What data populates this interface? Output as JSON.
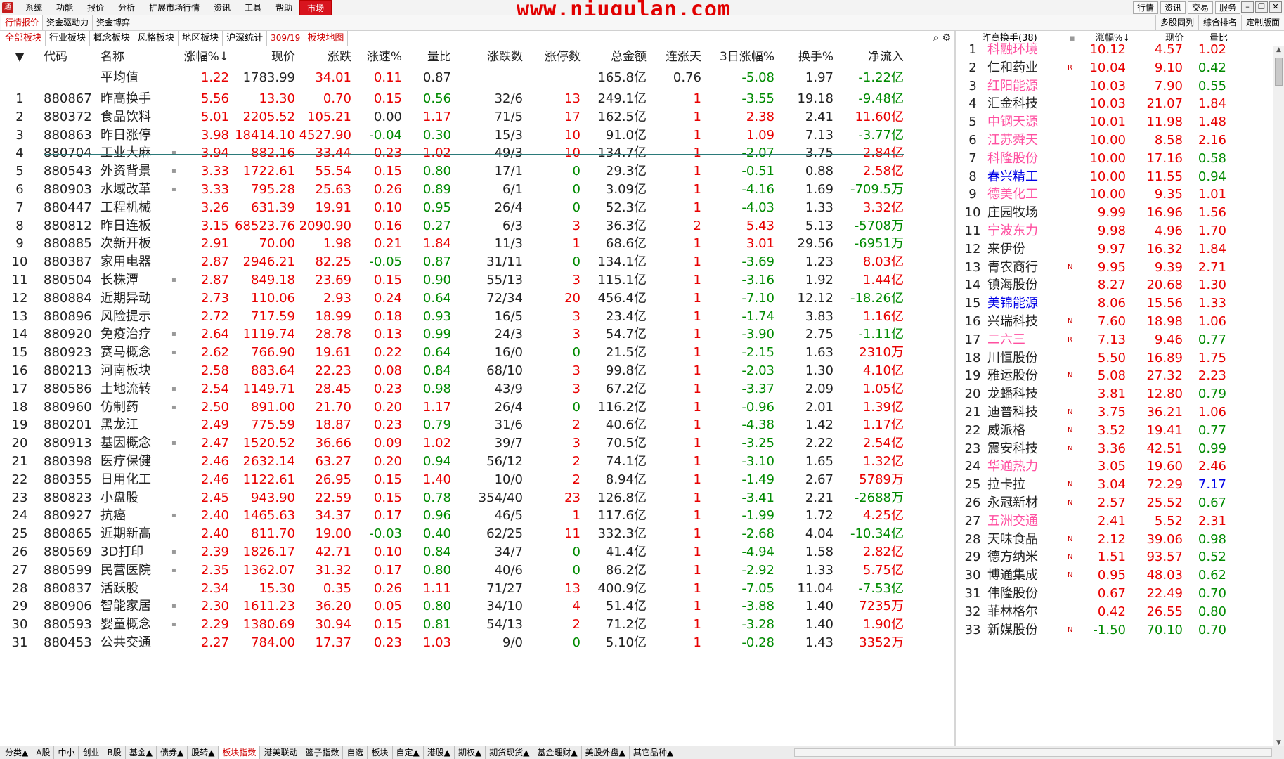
{
  "menubar": {
    "items": [
      "系统",
      "功能",
      "报价",
      "分析",
      "扩展市场行情",
      "资讯",
      "工具",
      "帮助",
      "市场"
    ],
    "watermark": "www.niugulan.com",
    "right_buttons": [
      "行情",
      "资讯",
      "交易",
      "服务"
    ]
  },
  "subbar": {
    "left": [
      "行情报价",
      "资金驱动力",
      "资金博弈"
    ],
    "right": [
      "多股同列",
      "综合排名",
      "定制版面"
    ]
  },
  "catbar": {
    "items": [
      "全部板块",
      "行业板块",
      "概念板块",
      "风格板块",
      "地区板块",
      "沪深统计"
    ],
    "count": "309/19",
    "map": "板块地图"
  },
  "table": {
    "headers": {
      "code": "代码",
      "name": "名称",
      "pct": "涨幅%↓",
      "price": "现价",
      "chg": "涨跌",
      "speed": "涨速%",
      "vr": "量比",
      "ud": "涨跌数",
      "lim": "涨停数",
      "amt": "总金额",
      "days": "连涨天",
      "d3": "3日涨幅%",
      "turn": "换手%",
      "net": "净流入"
    },
    "avg": {
      "name": "平均值",
      "pct": "1.22",
      "price": "1783.99",
      "chg": "34.01",
      "speed": "0.11",
      "vr": "0.87",
      "amt": "165.8亿",
      "days": "0.76",
      "d3": "-5.08",
      "turn": "1.97",
      "net": "-1.22亿"
    },
    "rows": [
      {
        "idx": "1",
        "code": "880867",
        "name": "昨高换手",
        "dot": false,
        "pct": "5.56",
        "price": "13.30",
        "chg": "0.70",
        "speed": "0.15",
        "vr": "0.56",
        "ud": "32/6",
        "lim": "13",
        "amt": "249.1亿",
        "days": "1",
        "d3": "-3.55",
        "turn": "19.18",
        "net": "-9.48亿"
      },
      {
        "idx": "2",
        "code": "880372",
        "name": "食品饮料",
        "dot": false,
        "pct": "5.01",
        "price": "2205.52",
        "chg": "105.21",
        "speed": "0.00",
        "vr": "1.17",
        "ud": "71/5",
        "lim": "17",
        "amt": "162.5亿",
        "days": "1",
        "d3": "2.38",
        "turn": "2.41",
        "net": "11.60亿"
      },
      {
        "idx": "3",
        "code": "880863",
        "name": "昨日涨停",
        "dot": false,
        "pct": "3.98",
        "price": "18414.10",
        "chg": "4527.90",
        "speed": "-0.04",
        "vr": "0.30",
        "ud": "15/3",
        "lim": "10",
        "amt": "91.0亿",
        "days": "1",
        "d3": "1.09",
        "turn": "7.13",
        "net": "-3.77亿"
      },
      {
        "idx": "4",
        "code": "880704",
        "name": "工业大麻",
        "dot": true,
        "pct": "3.94",
        "price": "882.16",
        "chg": "33.44",
        "speed": "0.23",
        "vr": "1.02",
        "ud": "49/3",
        "lim": "10",
        "amt": "134.7亿",
        "days": "1",
        "d3": "-2.07",
        "turn": "3.75",
        "net": "2.84亿"
      },
      {
        "idx": "5",
        "code": "880543",
        "name": "外资背景",
        "dot": true,
        "pct": "3.33",
        "price": "1722.61",
        "chg": "55.54",
        "speed": "0.15",
        "vr": "0.80",
        "ud": "17/1",
        "lim": "0",
        "amt": "29.3亿",
        "days": "1",
        "d3": "-0.51",
        "turn": "0.88",
        "net": "2.58亿"
      },
      {
        "idx": "6",
        "code": "880903",
        "name": "水域改革",
        "dot": true,
        "pct": "3.33",
        "price": "795.28",
        "chg": "25.63",
        "speed": "0.26",
        "vr": "0.89",
        "ud": "6/1",
        "lim": "0",
        "amt": "3.09亿",
        "days": "1",
        "d3": "-4.16",
        "turn": "1.69",
        "net": "-709.5万"
      },
      {
        "idx": "7",
        "code": "880447",
        "name": "工程机械",
        "dot": false,
        "pct": "3.26",
        "price": "631.39",
        "chg": "19.91",
        "speed": "0.10",
        "vr": "0.95",
        "ud": "26/4",
        "lim": "0",
        "amt": "52.3亿",
        "days": "1",
        "d3": "-4.03",
        "turn": "1.33",
        "net": "3.32亿"
      },
      {
        "idx": "8",
        "code": "880812",
        "name": "昨日连板",
        "dot": false,
        "pct": "3.15",
        "price": "68523.76",
        "chg": "2090.90",
        "speed": "0.16",
        "vr": "0.27",
        "ud": "6/3",
        "lim": "3",
        "amt": "36.3亿",
        "days": "2",
        "d3": "5.43",
        "turn": "5.13",
        "net": "-5708万"
      },
      {
        "idx": "9",
        "code": "880885",
        "name": "次新开板",
        "dot": false,
        "pct": "2.91",
        "price": "70.00",
        "chg": "1.98",
        "speed": "0.21",
        "vr": "1.84",
        "ud": "11/3",
        "lim": "1",
        "amt": "68.6亿",
        "days": "1",
        "d3": "3.01",
        "turn": "29.56",
        "net": "-6951万"
      },
      {
        "idx": "10",
        "code": "880387",
        "name": "家用电器",
        "dot": false,
        "pct": "2.87",
        "price": "2946.21",
        "chg": "82.25",
        "speed": "-0.05",
        "vr": "0.87",
        "ud": "31/11",
        "lim": "0",
        "amt": "134.1亿",
        "days": "1",
        "d3": "-3.69",
        "turn": "1.23",
        "net": "8.03亿"
      },
      {
        "idx": "11",
        "code": "880504",
        "name": "长株潭",
        "dot": true,
        "pct": "2.87",
        "price": "849.18",
        "chg": "23.69",
        "speed": "0.15",
        "vr": "0.90",
        "ud": "55/13",
        "lim": "3",
        "amt": "115.1亿",
        "days": "1",
        "d3": "-3.16",
        "turn": "1.92",
        "net": "1.44亿"
      },
      {
        "idx": "12",
        "code": "880884",
        "name": "近期异动",
        "dot": false,
        "pct": "2.73",
        "price": "110.06",
        "chg": "2.93",
        "speed": "0.24",
        "vr": "0.64",
        "ud": "72/34",
        "lim": "20",
        "amt": "456.4亿",
        "days": "1",
        "d3": "-7.10",
        "turn": "12.12",
        "net": "-18.26亿"
      },
      {
        "idx": "13",
        "code": "880896",
        "name": "风险提示",
        "dot": false,
        "pct": "2.72",
        "price": "717.59",
        "chg": "18.99",
        "speed": "0.18",
        "vr": "0.93",
        "ud": "16/5",
        "lim": "3",
        "amt": "23.4亿",
        "days": "1",
        "d3": "-1.74",
        "turn": "3.83",
        "net": "1.16亿"
      },
      {
        "idx": "14",
        "code": "880920",
        "name": "免疫治疗",
        "dot": true,
        "pct": "2.64",
        "price": "1119.74",
        "chg": "28.78",
        "speed": "0.13",
        "vr": "0.99",
        "ud": "24/3",
        "lim": "3",
        "amt": "54.7亿",
        "days": "1",
        "d3": "-3.90",
        "turn": "2.75",
        "net": "-1.11亿"
      },
      {
        "idx": "15",
        "code": "880923",
        "name": "赛马概念",
        "dot": true,
        "pct": "2.62",
        "price": "766.90",
        "chg": "19.61",
        "speed": "0.22",
        "vr": "0.64",
        "ud": "16/0",
        "lim": "0",
        "amt": "21.5亿",
        "days": "1",
        "d3": "-2.15",
        "turn": "1.63",
        "net": "2310万"
      },
      {
        "idx": "16",
        "code": "880213",
        "name": "河南板块",
        "dot": false,
        "pct": "2.58",
        "price": "883.64",
        "chg": "22.23",
        "speed": "0.08",
        "vr": "0.84",
        "ud": "68/10",
        "lim": "3",
        "amt": "99.8亿",
        "days": "1",
        "d3": "-2.03",
        "turn": "1.30",
        "net": "4.10亿"
      },
      {
        "idx": "17",
        "code": "880586",
        "name": "土地流转",
        "dot": true,
        "pct": "2.54",
        "price": "1149.71",
        "chg": "28.45",
        "speed": "0.23",
        "vr": "0.98",
        "ud": "43/9",
        "lim": "3",
        "amt": "67.2亿",
        "days": "1",
        "d3": "-3.37",
        "turn": "2.09",
        "net": "1.05亿"
      },
      {
        "idx": "18",
        "code": "880960",
        "name": "仿制药",
        "dot": true,
        "pct": "2.50",
        "price": "891.00",
        "chg": "21.70",
        "speed": "0.20",
        "vr": "1.17",
        "ud": "26/4",
        "lim": "0",
        "amt": "116.2亿",
        "days": "1",
        "d3": "-0.96",
        "turn": "2.01",
        "net": "1.39亿"
      },
      {
        "idx": "19",
        "code": "880201",
        "name": "黑龙江",
        "dot": false,
        "pct": "2.49",
        "price": "775.59",
        "chg": "18.87",
        "speed": "0.23",
        "vr": "0.79",
        "ud": "31/6",
        "lim": "2",
        "amt": "40.6亿",
        "days": "1",
        "d3": "-4.38",
        "turn": "1.42",
        "net": "1.17亿"
      },
      {
        "idx": "20",
        "code": "880913",
        "name": "基因概念",
        "dot": true,
        "pct": "2.47",
        "price": "1520.52",
        "chg": "36.66",
        "speed": "0.09",
        "vr": "1.02",
        "ud": "39/7",
        "lim": "3",
        "amt": "70.5亿",
        "days": "1",
        "d3": "-3.25",
        "turn": "2.22",
        "net": "2.54亿"
      },
      {
        "idx": "21",
        "code": "880398",
        "name": "医疗保健",
        "dot": false,
        "pct": "2.46",
        "price": "2632.14",
        "chg": "63.27",
        "speed": "0.20",
        "vr": "0.94",
        "ud": "56/12",
        "lim": "2",
        "amt": "74.1亿",
        "days": "1",
        "d3": "-3.10",
        "turn": "1.65",
        "net": "1.32亿"
      },
      {
        "idx": "22",
        "code": "880355",
        "name": "日用化工",
        "dot": false,
        "pct": "2.46",
        "price": "1122.61",
        "chg": "26.95",
        "speed": "0.15",
        "vr": "1.40",
        "ud": "10/0",
        "lim": "2",
        "amt": "8.94亿",
        "days": "1",
        "d3": "-1.49",
        "turn": "2.67",
        "net": "5789万"
      },
      {
        "idx": "23",
        "code": "880823",
        "name": "小盘股",
        "dot": false,
        "pct": "2.45",
        "price": "943.90",
        "chg": "22.59",
        "speed": "0.15",
        "vr": "0.78",
        "ud": "354/40",
        "lim": "23",
        "amt": "126.8亿",
        "days": "1",
        "d3": "-3.41",
        "turn": "2.21",
        "net": "-2688万"
      },
      {
        "idx": "24",
        "code": "880927",
        "name": "抗癌",
        "dot": true,
        "pct": "2.40",
        "price": "1465.63",
        "chg": "34.37",
        "speed": "0.17",
        "vr": "0.96",
        "ud": "46/5",
        "lim": "1",
        "amt": "117.6亿",
        "days": "1",
        "d3": "-1.99",
        "turn": "1.72",
        "net": "4.25亿"
      },
      {
        "idx": "25",
        "code": "880865",
        "name": "近期新高",
        "dot": false,
        "pct": "2.40",
        "price": "811.70",
        "chg": "19.00",
        "speed": "-0.03",
        "vr": "0.40",
        "ud": "62/25",
        "lim": "11",
        "amt": "332.3亿",
        "days": "1",
        "d3": "-2.68",
        "turn": "4.04",
        "net": "-10.34亿"
      },
      {
        "idx": "26",
        "code": "880569",
        "name": "3D打印",
        "dot": true,
        "pct": "2.39",
        "price": "1826.17",
        "chg": "42.71",
        "speed": "0.10",
        "vr": "0.84",
        "ud": "34/7",
        "lim": "0",
        "amt": "41.4亿",
        "days": "1",
        "d3": "-4.94",
        "turn": "1.58",
        "net": "2.82亿"
      },
      {
        "idx": "27",
        "code": "880599",
        "name": "民营医院",
        "dot": true,
        "pct": "2.35",
        "price": "1362.07",
        "chg": "31.32",
        "speed": "0.17",
        "vr": "0.80",
        "ud": "40/6",
        "lim": "0",
        "amt": "86.2亿",
        "days": "1",
        "d3": "-2.92",
        "turn": "1.33",
        "net": "5.75亿"
      },
      {
        "idx": "28",
        "code": "880837",
        "name": "活跃股",
        "dot": false,
        "pct": "2.34",
        "price": "15.30",
        "chg": "0.35",
        "speed": "0.26",
        "vr": "1.11",
        "ud": "71/27",
        "lim": "13",
        "amt": "400.9亿",
        "days": "1",
        "d3": "-7.05",
        "turn": "11.04",
        "net": "-7.53亿"
      },
      {
        "idx": "29",
        "code": "880906",
        "name": "智能家居",
        "dot": true,
        "pct": "2.30",
        "price": "1611.23",
        "chg": "36.20",
        "speed": "0.05",
        "vr": "0.80",
        "ud": "34/10",
        "lim": "4",
        "amt": "51.4亿",
        "days": "1",
        "d3": "-3.88",
        "turn": "1.40",
        "net": "7235万"
      },
      {
        "idx": "30",
        "code": "880593",
        "name": "婴童概念",
        "dot": true,
        "pct": "2.29",
        "price": "1380.69",
        "chg": "30.94",
        "speed": "0.15",
        "vr": "0.81",
        "ud": "54/13",
        "lim": "2",
        "amt": "71.2亿",
        "days": "1",
        "d3": "-3.28",
        "turn": "1.40",
        "net": "1.90亿"
      },
      {
        "idx": "31",
        "code": "880453",
        "name": "公共交通",
        "dot": false,
        "pct": "2.27",
        "price": "784.00",
        "chg": "17.37",
        "speed": "0.23",
        "vr": "1.03",
        "ud": "9/0",
        "lim": "0",
        "amt": "5.10亿",
        "days": "1",
        "d3": "-0.28",
        "turn": "1.43",
        "net": "3352万"
      }
    ]
  },
  "right_panel": {
    "title": "昨高换手(38)",
    "headers": {
      "pct": "涨幅%↓",
      "price": "现价",
      "ratio": "量比"
    },
    "rows": [
      {
        "idx": "1",
        "name": "科融环境",
        "color": "pink",
        "tag": "",
        "pct": "10.12",
        "price": "4.57",
        "ratio": "1.02"
      },
      {
        "idx": "2",
        "name": "仁和药业",
        "color": "black",
        "tag": "R",
        "pct": "10.04",
        "price": "9.10",
        "ratio": "0.42"
      },
      {
        "idx": "3",
        "name": "红阳能源",
        "color": "pink",
        "tag": "",
        "pct": "10.03",
        "price": "7.90",
        "ratio": "0.55"
      },
      {
        "idx": "4",
        "name": "汇金科技",
        "color": "black",
        "tag": "",
        "pct": "10.03",
        "price": "21.07",
        "ratio": "1.84"
      },
      {
        "idx": "5",
        "name": "中钢天源",
        "color": "pink",
        "tag": "",
        "pct": "10.01",
        "price": "11.98",
        "ratio": "1.48"
      },
      {
        "idx": "6",
        "name": "江苏舜天",
        "color": "pink",
        "tag": "",
        "pct": "10.00",
        "price": "8.58",
        "ratio": "2.16"
      },
      {
        "idx": "7",
        "name": "科隆股份",
        "color": "pink",
        "tag": "",
        "pct": "10.00",
        "price": "17.16",
        "ratio": "0.58"
      },
      {
        "idx": "8",
        "name": "春兴精工",
        "color": "blue",
        "tag": "",
        "pct": "10.00",
        "price": "11.55",
        "ratio": "0.94"
      },
      {
        "idx": "9",
        "name": "德美化工",
        "color": "pink",
        "tag": "",
        "pct": "10.00",
        "price": "9.35",
        "ratio": "1.01"
      },
      {
        "idx": "10",
        "name": "庄园牧场",
        "color": "black",
        "tag": "",
        "pct": "9.99",
        "price": "16.96",
        "ratio": "1.56"
      },
      {
        "idx": "11",
        "name": "宁波东力",
        "color": "pink",
        "tag": "",
        "pct": "9.98",
        "price": "4.96",
        "ratio": "1.70"
      },
      {
        "idx": "12",
        "name": "来伊份",
        "color": "black",
        "tag": "",
        "pct": "9.97",
        "price": "16.32",
        "ratio": "1.84"
      },
      {
        "idx": "13",
        "name": "青农商行",
        "color": "black",
        "tag": "N",
        "pct": "9.95",
        "price": "9.39",
        "ratio": "2.71"
      },
      {
        "idx": "14",
        "name": "镇海股份",
        "color": "black",
        "tag": "",
        "pct": "8.27",
        "price": "20.68",
        "ratio": "1.30"
      },
      {
        "idx": "15",
        "name": "美锦能源",
        "color": "blue",
        "tag": "",
        "pct": "8.06",
        "price": "15.56",
        "ratio": "1.33"
      },
      {
        "idx": "16",
        "name": "兴瑞科技",
        "color": "black",
        "tag": "N",
        "pct": "7.60",
        "price": "18.98",
        "ratio": "1.06"
      },
      {
        "idx": "17",
        "name": "二六三",
        "color": "pink",
        "tag": "R",
        "pct": "7.13",
        "price": "9.46",
        "ratio": "0.77"
      },
      {
        "idx": "18",
        "name": "川恒股份",
        "color": "black",
        "tag": "",
        "pct": "5.50",
        "price": "16.89",
        "ratio": "1.75"
      },
      {
        "idx": "19",
        "name": "雅运股份",
        "color": "black",
        "tag": "N",
        "pct": "5.08",
        "price": "27.32",
        "ratio": "2.23"
      },
      {
        "idx": "20",
        "name": "龙蟠科技",
        "color": "black",
        "tag": "",
        "pct": "3.81",
        "price": "12.80",
        "ratio": "0.79"
      },
      {
        "idx": "21",
        "name": "迪普科技",
        "color": "black",
        "tag": "N",
        "pct": "3.75",
        "price": "36.21",
        "ratio": "1.06"
      },
      {
        "idx": "22",
        "name": "威派格",
        "color": "black",
        "tag": "N",
        "pct": "3.52",
        "price": "19.41",
        "ratio": "0.77"
      },
      {
        "idx": "23",
        "name": "震安科技",
        "color": "black",
        "tag": "N",
        "pct": "3.36",
        "price": "42.51",
        "ratio": "0.99"
      },
      {
        "idx": "24",
        "name": "华通热力",
        "color": "pink",
        "tag": "",
        "pct": "3.05",
        "price": "19.60",
        "ratio": "2.46"
      },
      {
        "idx": "25",
        "name": "拉卡拉",
        "color": "black",
        "tag": "N",
        "pct": "3.04",
        "price": "72.29",
        "ratio": "7.17"
      },
      {
        "idx": "26",
        "name": "永冠新材",
        "color": "black",
        "tag": "N",
        "pct": "2.57",
        "price": "25.52",
        "ratio": "0.67"
      },
      {
        "idx": "27",
        "name": "五洲交通",
        "color": "pink",
        "tag": "",
        "pct": "2.41",
        "price": "5.52",
        "ratio": "2.31"
      },
      {
        "idx": "28",
        "name": "天味食品",
        "color": "black",
        "tag": "N",
        "pct": "2.12",
        "price": "39.06",
        "ratio": "0.98"
      },
      {
        "idx": "29",
        "name": "德方纳米",
        "color": "black",
        "tag": "N",
        "pct": "1.51",
        "price": "93.57",
        "ratio": "0.52"
      },
      {
        "idx": "30",
        "name": "博通集成",
        "color": "black",
        "tag": "N",
        "pct": "0.95",
        "price": "48.03",
        "ratio": "0.62"
      },
      {
        "idx": "31",
        "name": "伟隆股份",
        "color": "black",
        "tag": "",
        "pct": "0.67",
        "price": "22.49",
        "ratio": "0.70"
      },
      {
        "idx": "32",
        "name": "菲林格尔",
        "color": "black",
        "tag": "",
        "pct": "0.42",
        "price": "26.55",
        "ratio": "0.80"
      },
      {
        "idx": "33",
        "name": "新媒股份",
        "color": "black",
        "tag": "N",
        "pct": "-1.50",
        "price": "70.10",
        "ratio": "0.70"
      }
    ]
  },
  "bottom_tabs": [
    "分类▲",
    "A股",
    "中小",
    "创业",
    "B股",
    "基金▲",
    "债券▲",
    "股转▲",
    "板块指数",
    "港美联动",
    "篮子指数",
    "自选",
    "板块",
    "自定▲",
    "港股▲",
    "期权▲",
    "期货现货▲",
    "基金理财▲",
    "美股外盘▲",
    "其它品种▲"
  ],
  "bottom_active": "板块指数",
  "colors": {
    "up": "#e80000",
    "down": "#008a00",
    "pink": "#ff4fa0",
    "blue": "#0000e6",
    "text": "#222222"
  }
}
